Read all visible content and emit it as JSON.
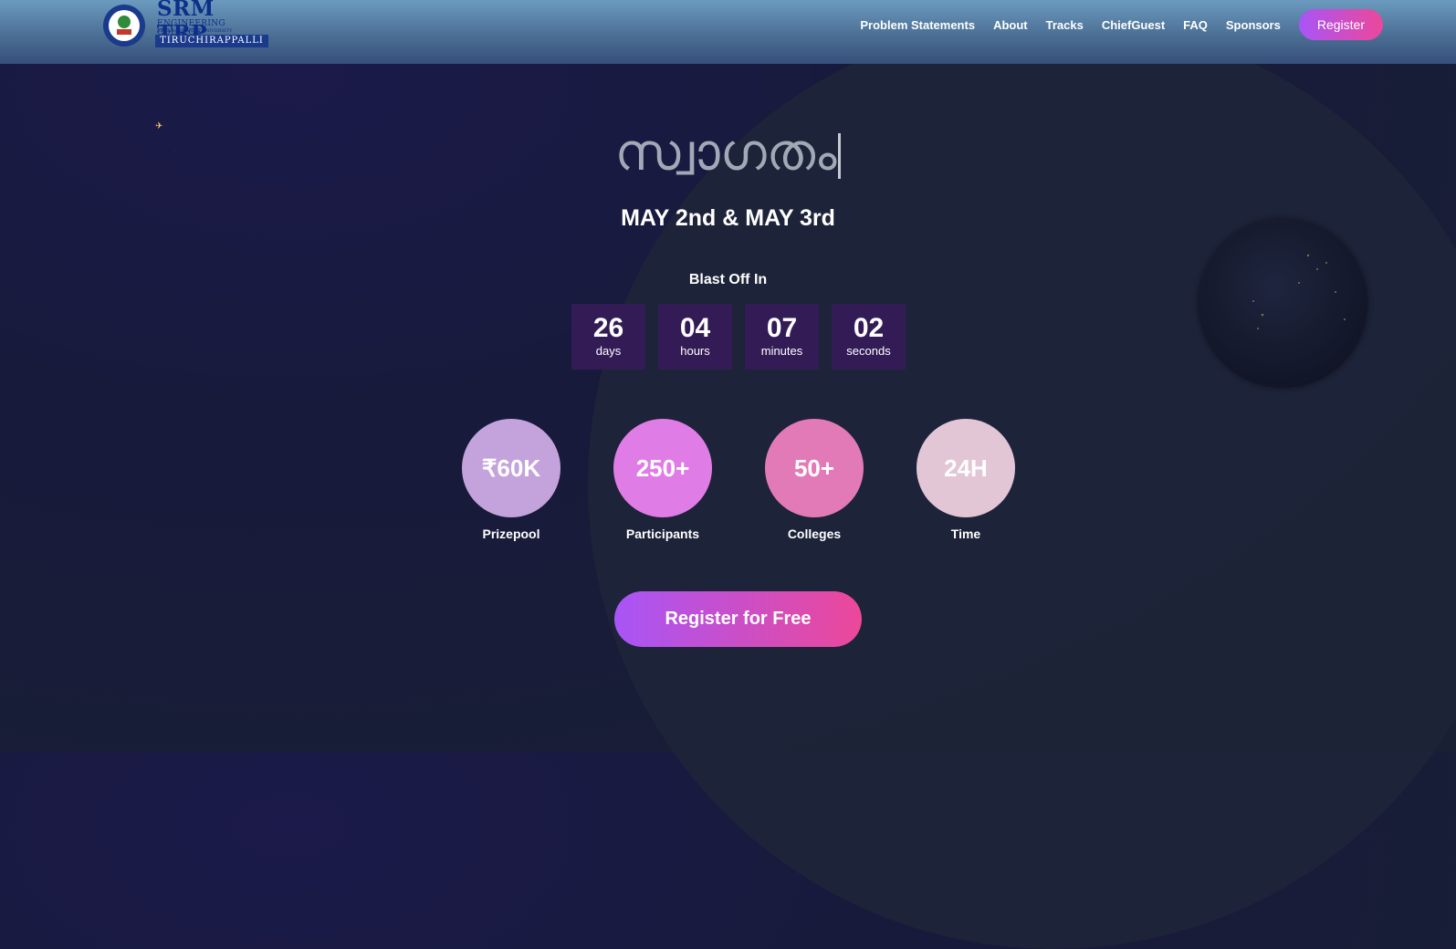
{
  "header": {
    "logo": {
      "name": "SRM TRP",
      "subtitle": "ENGINEERING COLLEGE",
      "affiliation": "Affiliated to ANNA UNIVERSITY",
      "city": "TIRUCHIRAPPALLI"
    },
    "nav": [
      "Problem Statements",
      "About",
      "Tracks",
      "ChiefGuest",
      "FAQ",
      "Sponsors"
    ],
    "register_label": "Register"
  },
  "hero": {
    "title": "സ്വാഗതം",
    "date": "MAY 2nd & MAY 3rd",
    "countdown_label": "Blast Off In",
    "countdown": [
      {
        "value": "26",
        "unit": "days"
      },
      {
        "value": "04",
        "unit": "hours"
      },
      {
        "value": "07",
        "unit": "minutes"
      },
      {
        "value": "02",
        "unit": "seconds"
      }
    ],
    "stats": [
      {
        "value": "₹60K",
        "label": "Prizepool",
        "color": "#c4a3dc"
      },
      {
        "value": "250+",
        "label": "Participants",
        "color": "#e07ce6"
      },
      {
        "value": "50+",
        "label": "Colleges",
        "color": "#e37ab8"
      },
      {
        "value": "24H",
        "label": "Time",
        "color": "#e2c6d6"
      }
    ],
    "cta_label": "Register for Free"
  },
  "colors": {
    "accent_start": "#a855f7",
    "accent_end": "#ec4899",
    "countdown_bg": "#331c56"
  }
}
